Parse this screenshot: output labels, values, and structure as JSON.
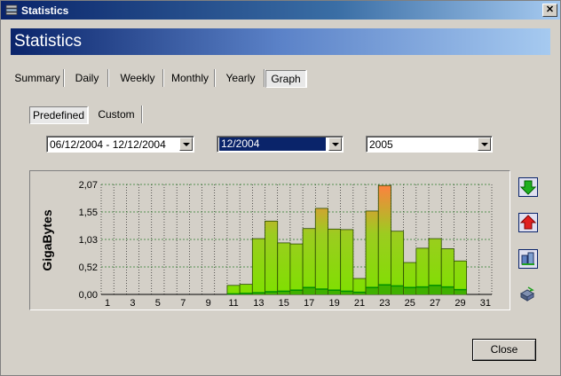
{
  "window": {
    "title": "Statistics"
  },
  "header": {
    "title": "Statistics"
  },
  "tabs": [
    {
      "label": "Summary",
      "active": false
    },
    {
      "label": "Daily",
      "active": false
    },
    {
      "label": "Weekly",
      "active": false
    },
    {
      "label": "Monthly",
      "active": false
    },
    {
      "label": "Yearly",
      "active": false
    },
    {
      "label": "Graph",
      "active": true
    }
  ],
  "subtabs": [
    {
      "label": "Predefined",
      "active": true
    },
    {
      "label": "Custom",
      "active": false
    }
  ],
  "selectors": {
    "week": "06/12/2004 - 12/12/2004",
    "month": "12/2004",
    "year": "2005"
  },
  "buttons": {
    "close": "Close"
  },
  "icons": {
    "download": "arrow-down-green-icon",
    "upload": "arrow-up-red-icon",
    "combined": "stacked-arrows-icon",
    "export": "export-icon"
  },
  "colors": {
    "bar_low": "#7fe000",
    "bar_high": "#ff8040",
    "upload_band": "#009000",
    "grid": "#000000"
  },
  "chart_data": {
    "type": "bar",
    "ylabel": "GigaBytes",
    "xlabel": "",
    "ylim": [
      0,
      2.07
    ],
    "yticks": [
      "0,00",
      "0,52",
      "1,03",
      "1,55",
      "2,07"
    ],
    "xticks": [
      "1",
      "3",
      "5",
      "7",
      "9",
      "11",
      "13",
      "15",
      "17",
      "19",
      "21",
      "23",
      "25",
      "27",
      "29",
      "31"
    ],
    "categories": [
      1,
      2,
      3,
      4,
      5,
      6,
      7,
      8,
      9,
      10,
      11,
      12,
      13,
      14,
      15,
      16,
      17,
      18,
      19,
      20,
      21,
      22,
      23,
      24,
      25,
      26,
      27,
      28,
      29,
      30,
      31
    ],
    "series": [
      {
        "values": [
          0,
          0,
          0,
          0,
          0,
          0,
          0,
          0,
          0,
          0,
          0.17,
          0.19,
          1.05,
          1.38,
          0.97,
          0.95,
          1.24,
          1.62,
          1.23,
          1.22,
          0.3,
          1.57,
          2.05,
          1.19,
          0.6,
          0.87,
          1.05,
          0.86,
          0.63,
          0,
          0
        ]
      },
      {
        "values": [
          0,
          0,
          0,
          0,
          0,
          0,
          0,
          0,
          0,
          0,
          0.01,
          0.02,
          0.03,
          0.05,
          0.06,
          0.08,
          0.13,
          0.1,
          0.08,
          0.06,
          0.04,
          0.13,
          0.18,
          0.16,
          0.13,
          0.14,
          0.17,
          0.14,
          0.09,
          0,
          0
        ]
      }
    ],
    "grid": true,
    "legend": "none"
  }
}
